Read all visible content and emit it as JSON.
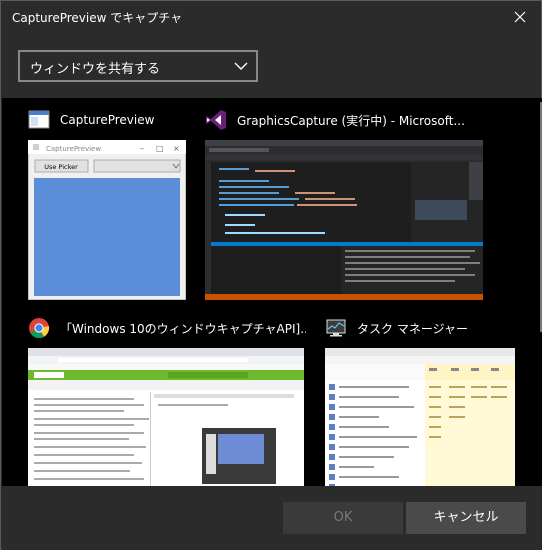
{
  "window": {
    "title": "CapturePreview でキャプチャ"
  },
  "dropdown": {
    "selected": "ウィンドウを共有する"
  },
  "cards": [
    {
      "name": "CapturePreview",
      "icon": "app-window-icon",
      "preview": {
        "title": "CapturePreview",
        "button": "Use Picker"
      }
    },
    {
      "name": "GraphicsCapture (実行中) - Microsoft...",
      "icon": "visual-studio-icon"
    },
    {
      "name": "「Windows 10のウィンドウキャプチャAPI]...",
      "icon": "chrome-icon"
    },
    {
      "name": "タスク マネージャー",
      "icon": "task-manager-icon"
    }
  ],
  "footer": {
    "ok_label": "OK",
    "cancel_label": "キャンセル"
  },
  "colors": {
    "background": "#2b2b2b",
    "grid": "#000000",
    "accent_blue": "#5b8dd9",
    "vs_purple": "#68217a"
  }
}
